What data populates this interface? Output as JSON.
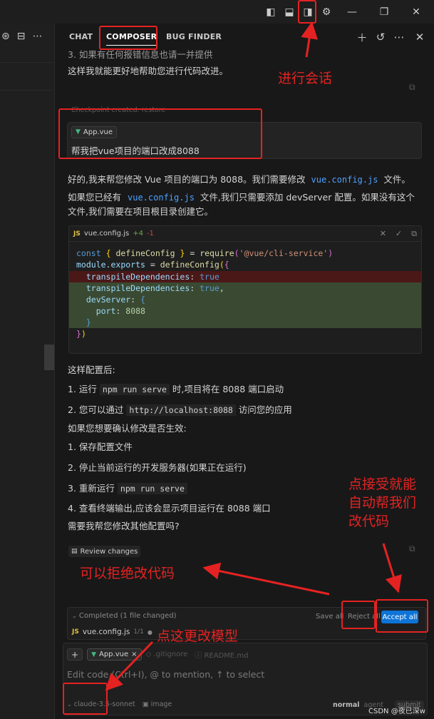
{
  "tabs": [
    {
      "label": "CHAT"
    },
    {
      "label": "COMPOSER"
    },
    {
      "label": "BUG FINDER"
    }
  ],
  "conversation": {
    "prev_line_cut": "3. 如果有任何报错信息也请一并提供",
    "prev_line": "这样我就能更好地帮助您进行代码改进。",
    "checkpoint": "Checkpoint created. restore",
    "user_file_chip": "App.vue",
    "user_message": "帮我把vue项目的端口改成8088",
    "reply_1_a": "好的,我来帮您修改 Vue 项目的端口为 8088。我们需要修改",
    "reply_1_code": "vue.config.js",
    "reply_1_b": "文件。",
    "reply_2_a": "如果您已经有",
    "reply_2_code": "vue.config.js",
    "reply_2_b": "文件,我们只需要添加 devServer 配置。如果没有这个",
    "reply_3": "文件,我们需要在项目根目录创建它。"
  },
  "code_block": {
    "filename": "vue.config.js",
    "lang_badge": "JS",
    "diff_add": "+4",
    "diff_del": "-1",
    "lines": [
      "const { defineConfig } = require('@vue/cli-service')",
      "module.exports = defineConfig({",
      "  transpileDependencies: true",
      "  transpileDependencies: true,",
      "  devServer: {",
      "    port: 8088",
      "  }",
      "})"
    ]
  },
  "after": {
    "l1": "这样配置后:",
    "l2_a": "1. 运行",
    "l2_code": "npm run serve",
    "l2_b": "时,项目将在 8088 端口启动",
    "l3_a": "2. 您可以通过",
    "l3_code": "http://localhost:8088",
    "l3_b": "访问您的应用",
    "l4": "如果您想要确认修改是否生效:",
    "l5": "1. 保存配置文件",
    "l6": "2. 停止当前运行的开发服务器(如果正在运行)",
    "l7_a": "3. 重新运行",
    "l7_code": "npm run serve",
    "l8": "4. 查看终端输出,应该会显示项目运行在 8088 端口",
    "l9": "需要我帮您修改其他配置吗?"
  },
  "review_changes": "Review changes",
  "completed": {
    "label": "Completed (1 file changed)",
    "save_all": "Save all",
    "reject_all": "Reject all",
    "accept_all": "Accept all",
    "file": "vue.config.js",
    "file_count": "1/1"
  },
  "input": {
    "add": "+",
    "chip_active": "App.vue",
    "chip_close": "×",
    "chip_2": ".gitignore",
    "chip_3": "README.md",
    "placeholder": "Edit code (Ctrl+I), @ to mention, ↑ to select",
    "model": "claude-3.5-sonnet",
    "image": "image",
    "mode_normal": "normal",
    "mode_agent": "agent",
    "submit": "submit"
  },
  "annotations": {
    "a1": "进行会话",
    "a2_l1": "点接受就能",
    "a2_l2": "自动帮我们",
    "a2_l3": "改代码",
    "a3": "可以拒绝改代码",
    "a4": "点这更改模型"
  },
  "watermark": "CSDN @夜已深w",
  "colors": {
    "accent_blue": "#0e74d8",
    "annotation_red": "#e52222",
    "vue_green": "#42b883"
  }
}
